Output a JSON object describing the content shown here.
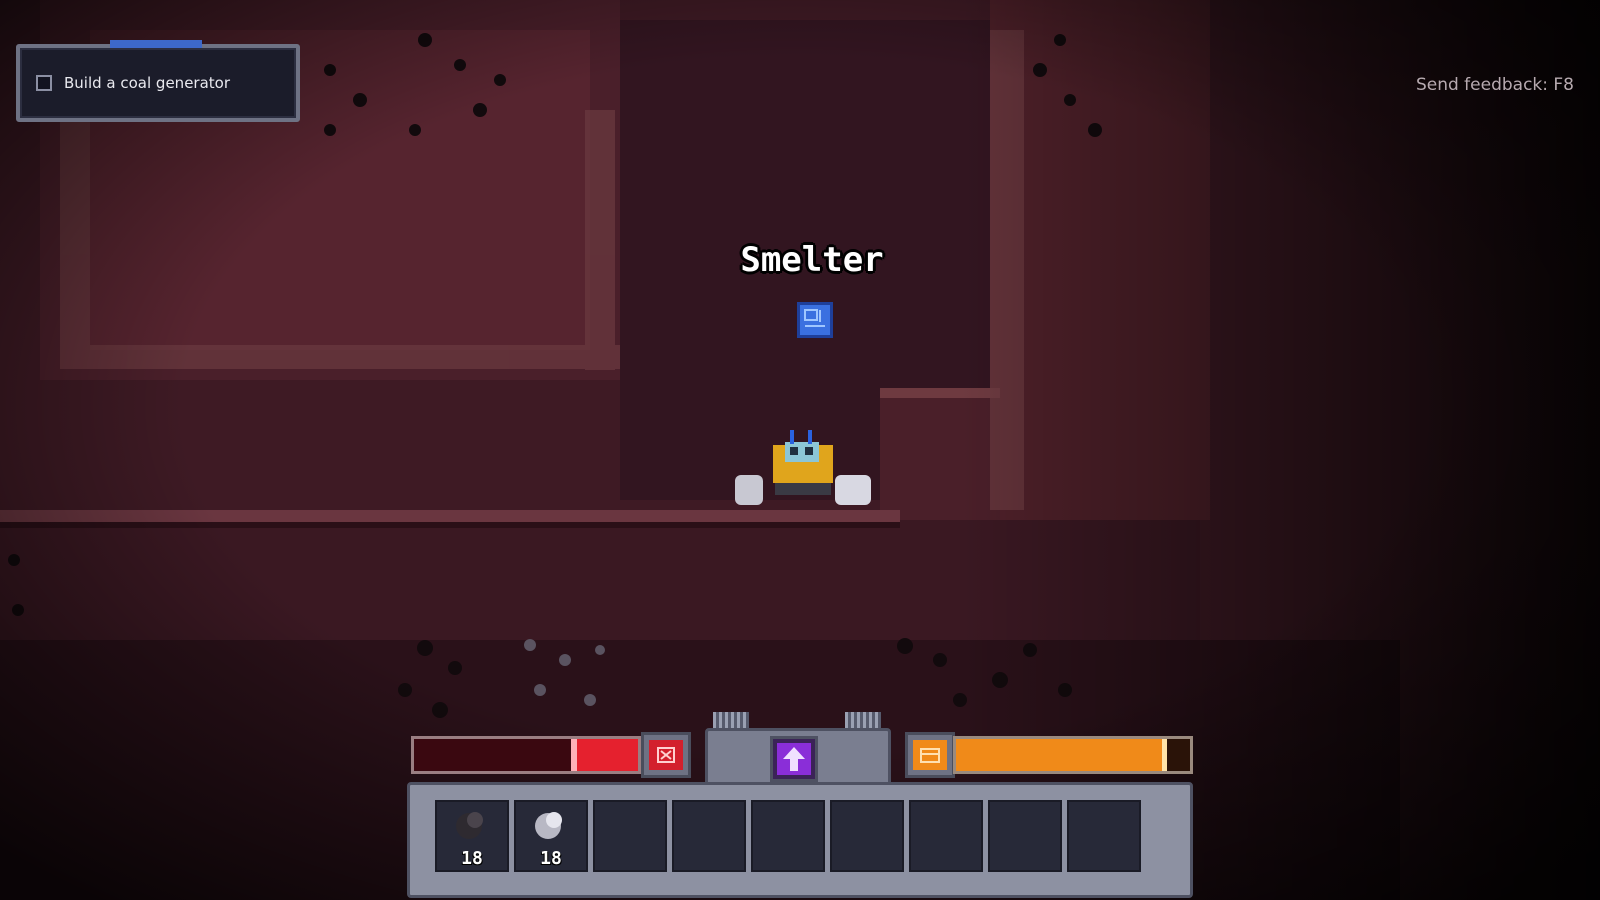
{
  "quest": {
    "label": "Build a coal generator",
    "completed": false
  },
  "feedback": "Send feedback: F8",
  "building_label": "Smelter",
  "hud": {
    "health_fraction": 0.3,
    "energy_fraction": 0.9,
    "colors": {
      "health": "#e5212e",
      "energy": "#f08a19",
      "upgrade": "#8a2ed8"
    }
  },
  "inventory": {
    "slots": [
      {
        "item": "coal-ore-icon",
        "count": "18"
      },
      {
        "item": "iron-ore-icon",
        "count": "18"
      },
      {
        "item": "",
        "count": ""
      },
      {
        "item": "",
        "count": ""
      },
      {
        "item": "",
        "count": ""
      },
      {
        "item": "",
        "count": ""
      },
      {
        "item": "",
        "count": ""
      },
      {
        "item": "",
        "count": ""
      },
      {
        "item": "",
        "count": ""
      }
    ]
  }
}
